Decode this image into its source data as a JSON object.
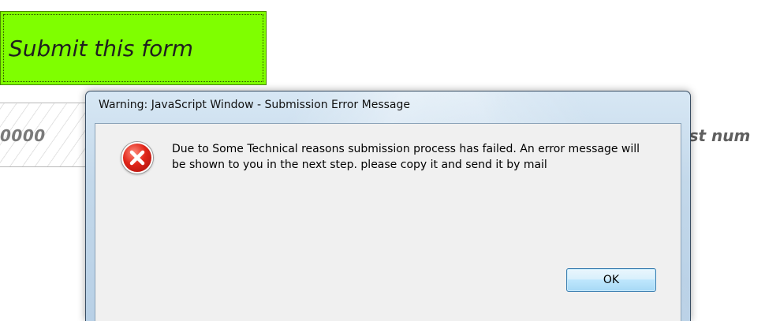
{
  "page": {
    "submit_button_label": "Submit  this form",
    "field_value_partial": "0000",
    "right_label_partial": "est num"
  },
  "dialog": {
    "title": "Warning: JavaScript Window - Submission Error Message",
    "message": "Due to Some Technical reasons submission process has failed. An error message will be shown to you in the next step. please copy it and send it by mail",
    "ok_label": "OK",
    "icon": "error-icon"
  },
  "colors": {
    "submit_bg": "#7fff00",
    "dialog_frame": "#c3d8ea",
    "error_red": "#e0261a"
  }
}
